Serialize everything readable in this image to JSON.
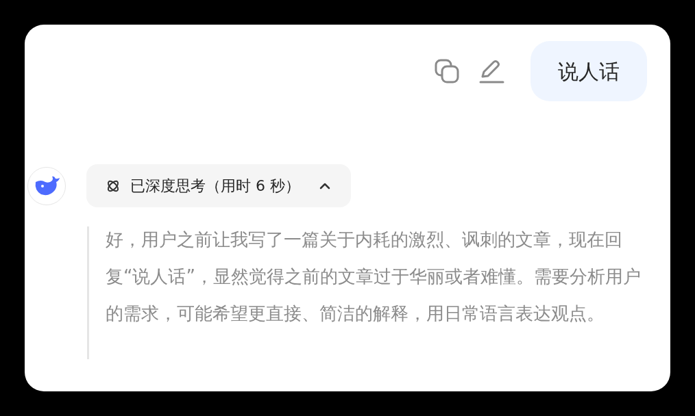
{
  "user_message": {
    "text": "说人话"
  },
  "thinking": {
    "label": "已深度思考（用时 6 秒）",
    "expanded": true,
    "text": "好，用户之前让我写了一篇关于内耗的激烈、讽刺的文章，现在回复“说人话”，显然觉得之前的文章过于华丽或者难懂。需要分析用户的需求，可能希望更直接、简洁的解释，用日常语言表达观点。"
  }
}
